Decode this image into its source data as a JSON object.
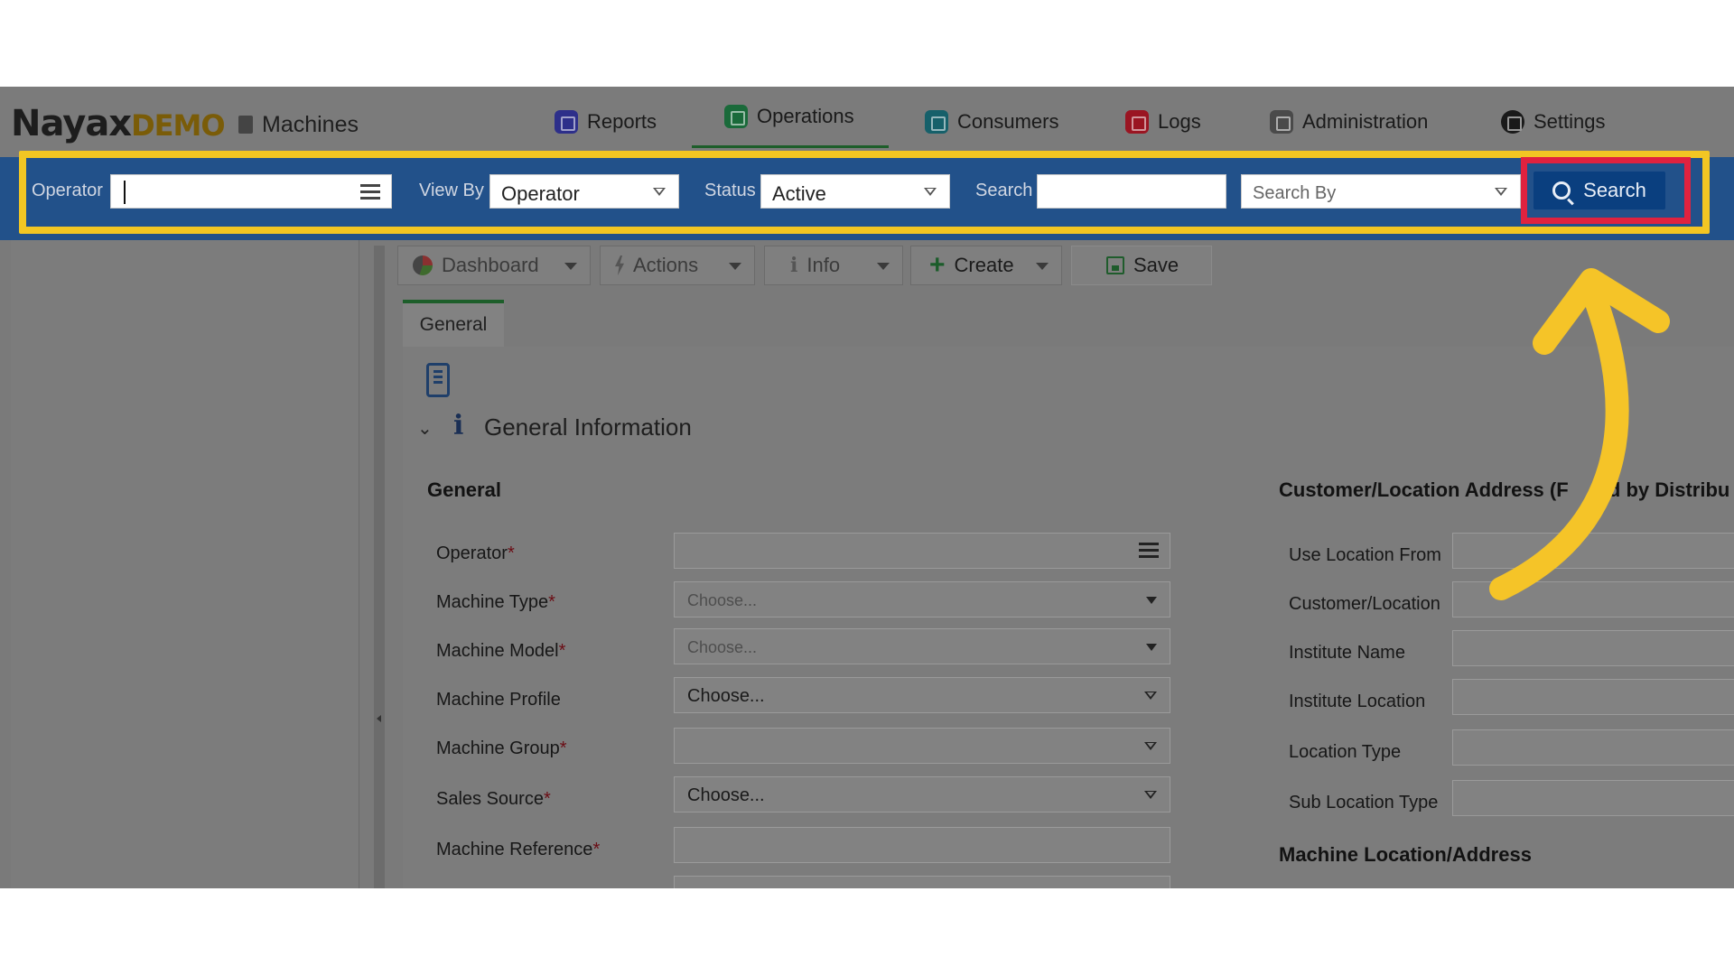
{
  "header": {
    "logo_main": "Nayax",
    "logo_suffix": "DEMO",
    "module_title": "Machines",
    "nav": [
      {
        "label": "Reports",
        "icon": "reports-icon"
      },
      {
        "label": "Operations",
        "icon": "operations-icon",
        "active": true
      },
      {
        "label": "Consumers",
        "icon": "consumers-icon"
      },
      {
        "label": "Logs",
        "icon": "logs-icon"
      },
      {
        "label": "Administration",
        "icon": "administration-icon"
      },
      {
        "label": "Settings",
        "icon": "settings-icon"
      }
    ]
  },
  "searchbar": {
    "operator_label": "Operator",
    "operator_value": "",
    "viewby_label": "View By",
    "viewby_value": "Operator",
    "status_label": "Status",
    "status_value": "Active",
    "search_label": "Search",
    "search_value": "",
    "searchby_placeholder": "Search By",
    "search_button": "Search"
  },
  "toolbar": {
    "dashboard": "Dashboard",
    "actions": "Actions",
    "info": "Info",
    "create": "Create",
    "save": "Save"
  },
  "tabs": {
    "general": "General"
  },
  "form": {
    "section_title": "General Information",
    "general_group": "General",
    "fields": [
      {
        "label": "Operator",
        "required": "*",
        "value": "",
        "kind": "list"
      },
      {
        "label": "Machine Type",
        "required": "*",
        "value": "Choose...",
        "kind": "placeholder"
      },
      {
        "label": "Machine Model",
        "required": "*",
        "value": "Choose...",
        "kind": "placeholder"
      },
      {
        "label": "Machine Profile",
        "required": "",
        "value": "Choose...",
        "kind": "value"
      },
      {
        "label": "Machine Group",
        "required": "*",
        "value": "",
        "kind": "value"
      },
      {
        "label": "Sales Source",
        "required": "*",
        "value": "Choose...",
        "kind": "value"
      },
      {
        "label": "Machine Reference",
        "required": "*",
        "value": "",
        "kind": "text"
      }
    ],
    "address_group": "Customer/Location Address (F",
    "address_group_tail": "ed by Distribu",
    "address_fields": [
      "Use Location From",
      "Customer/Location",
      "Institute Name",
      "Institute Location",
      "Location Type",
      "Sub Location Type"
    ],
    "machine_location_group": "Machine Location/Address"
  },
  "colors": {
    "header_bg": "#7b7b7b",
    "searchbar_bg": "#22518a",
    "highlight_yellow": "#f2c623",
    "highlight_red": "#e0223f",
    "search_button_bg": "#0a3f7f",
    "arrow": "#f5c428"
  }
}
